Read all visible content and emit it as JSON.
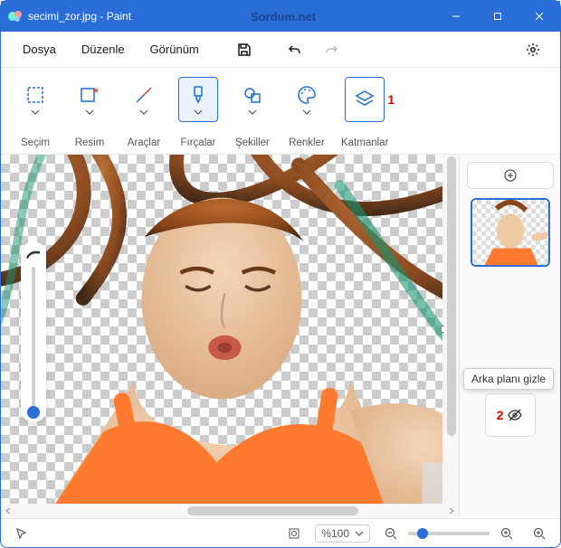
{
  "title": "secimi_zor.jpg - Paint",
  "watermark": "Sordum.net",
  "menu": {
    "file": "Dosya",
    "edit": "Düzenle",
    "view": "Görünüm"
  },
  "ribbon": {
    "selection": "Seçim",
    "image": "Resim",
    "tools": "Araçlar",
    "brushes": "Fırçalar",
    "shapes": "Şekiller",
    "colors": "Renkler",
    "layers": "Katmanlar"
  },
  "annotations": {
    "marker1": "1",
    "marker2": "2"
  },
  "tooltip": {
    "hide_background": "Arka planı gizle"
  },
  "zoom": {
    "value": "%100"
  }
}
